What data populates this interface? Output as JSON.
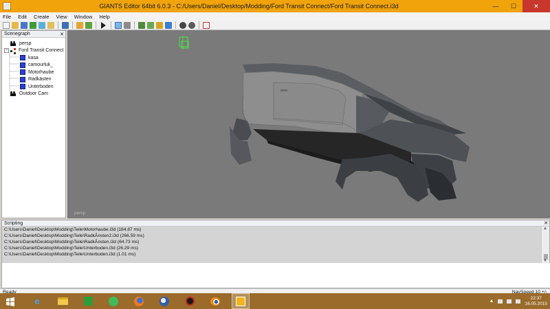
{
  "window": {
    "title": "GIANTS Editor 64bit 6.0.3 - C:/Users/Daniel/Desktop/Modding/Ford Transit Connect/Ford Transit Connect.i3d",
    "minimize_glyph": "—",
    "maximize_glyph": "☐",
    "close_glyph": "✕"
  },
  "menu": [
    "File",
    "Edit",
    "Create",
    "View",
    "Window",
    "Help"
  ],
  "toolbar": {
    "icons": [
      "new-file-icon",
      "open-folder-icon",
      "save-icon",
      "save-as-icon",
      "refresh-icon",
      "import-icon",
      "export-icon",
      "undo-icon",
      "redo-icon",
      "play-icon",
      "select-icon",
      "magnet-icon",
      "terrain-paint-icon",
      "terrain-height-icon",
      "foliage-paint-icon",
      "texture-paint-icon",
      "gear-settings-icon",
      "gear-render-icon",
      "clipboard-icon"
    ]
  },
  "scenegraph": {
    "title": "Scenegraph",
    "close_glyph": "✕",
    "nodes": [
      {
        "label": "persp",
        "icon": "camera-icon",
        "depth": 0
      },
      {
        "label": "Ford Transit Connect",
        "icon": "transform-group-icon",
        "depth": 0,
        "expanded": true
      },
      {
        "label": "kasa",
        "icon": "shape-cube-icon",
        "depth": 1
      },
      {
        "label": "camourluk_",
        "icon": "shape-cube-icon",
        "depth": 1
      },
      {
        "label": "Motorhaube",
        "icon": "shape-cube-icon",
        "depth": 1
      },
      {
        "label": "Radkästen",
        "icon": "shape-cube-icon",
        "depth": 1
      },
      {
        "label": "Unterboden",
        "icon": "shape-cube-icon",
        "depth": 1
      },
      {
        "label": "Outdoor Cam",
        "icon": "camera-icon",
        "depth": 0
      }
    ]
  },
  "viewport": {
    "camera_label": "persp",
    "background": "#7a7a7a",
    "model": "Ford Transit Connect van body shell"
  },
  "scripting": {
    "title": "Scripting",
    "close_glyph": "✕",
    "log": [
      "C:\\Users\\Daniel\\Desktop\\Modding\\Teile\\Motorhaube.i3d (184.87 ms)",
      "C:\\Users\\Daniel\\Desktop\\Modding\\Teile\\RadkÃ¤sten2.i3d (266.59 ms)",
      "C:\\Users\\Daniel\\Desktop\\Modding\\Teile\\RadkÃ¤sten.i3d (64.73 ms)",
      "C:\\Users\\Daniel\\Desktop\\Modding\\Teile\\Unterboden.i3d (26.29 ms)",
      "C:\\Users\\Daniel\\Desktop\\Modding\\Teile\\Unterboden.i3d (1.01 ms)"
    ]
  },
  "statusbar": {
    "left": "Ready",
    "right": "NavSpeed 10 +/-"
  },
  "taskbar": {
    "apps": [
      "start-button",
      "internet-explorer-icon",
      "file-explorer-icon",
      "store-icon",
      "chat-app-icon",
      "firefox-icon",
      "thunderbird-icon",
      "game-app-icon",
      "blender-icon",
      "giants-editor-icon"
    ],
    "time": "22:37",
    "date": "16.05.2015"
  },
  "colors": {
    "titlebar": "#f0a30a",
    "taskbar": "#9a6b2a",
    "close": "#c7372c",
    "viewport": "#7a7a7a",
    "van_body": "#4e5257"
  }
}
